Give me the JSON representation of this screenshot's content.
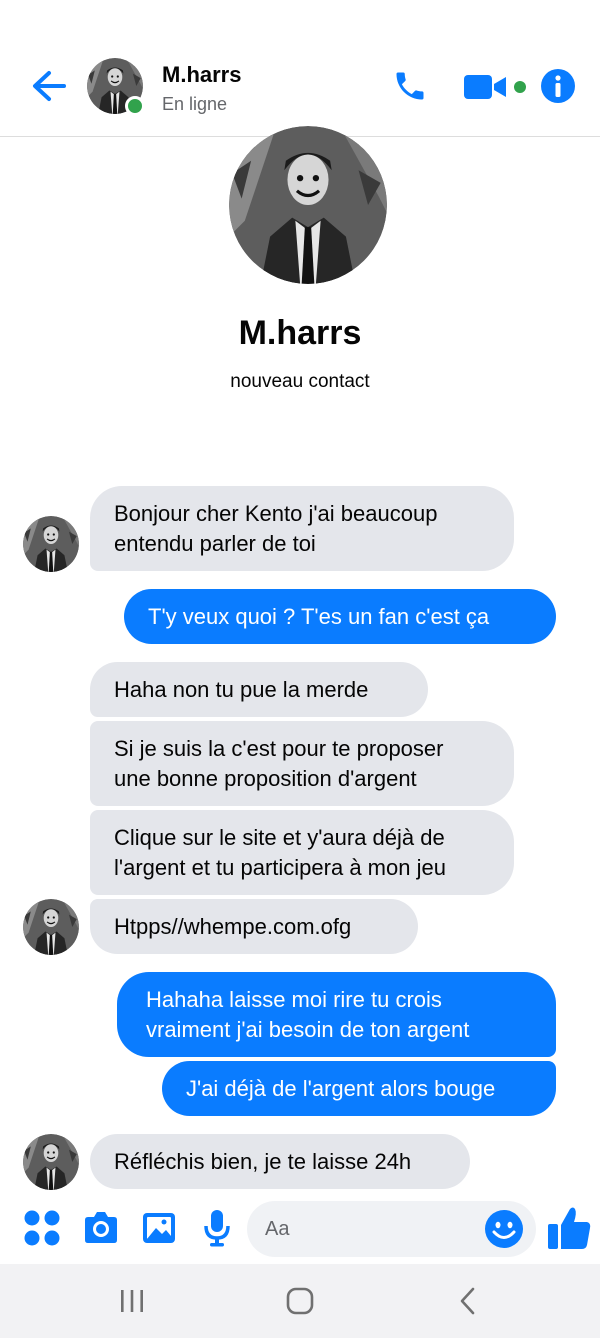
{
  "contact": {
    "name": "M.harrs",
    "status": "En ligne",
    "subtitle": "nouveau contact"
  },
  "header": {
    "back_icon": "arrow-left-icon",
    "call_icon": "phone-icon",
    "video_icon": "video-camera-icon",
    "info_icon": "info-icon"
  },
  "messages": [
    {
      "direction": "incoming",
      "lines": [
        "Bonjour cher Kento j'ai beaucoup",
        "entendu parler de toi"
      ]
    },
    {
      "direction": "outgoing",
      "lines": [
        "T'y veux quoi ? T'es un fan c'est ça"
      ]
    },
    {
      "direction": "incoming",
      "lines": [
        "Haha non tu pue la merde"
      ]
    },
    {
      "direction": "incoming",
      "lines": [
        "Si je suis la c'est pour te proposer",
        "une bonne proposition d'argent"
      ]
    },
    {
      "direction": "incoming",
      "lines": [
        "Clique sur le site et y'aura déjà de",
        "l'argent et tu participera à mon jeu"
      ]
    },
    {
      "direction": "incoming",
      "lines": [
        "Htpps//whempe.com.ofg"
      ]
    },
    {
      "direction": "outgoing",
      "lines": [
        "Hahaha laisse moi rire tu crois",
        "vraiment j'ai besoin de ton argent"
      ]
    },
    {
      "direction": "outgoing",
      "lines": [
        "J'ai déjà de l'argent alors bouge"
      ]
    },
    {
      "direction": "incoming",
      "lines": [
        "Réfléchis bien, je te laisse 24h"
      ]
    }
  ],
  "composer": {
    "placeholder": "Aa",
    "icons": [
      "menu-grid-icon",
      "camera-icon",
      "image-icon",
      "microphone-icon",
      "emoji-icon",
      "thumbs-up-icon"
    ]
  },
  "system_nav": {
    "icons": [
      "recent-apps-icon",
      "home-icon",
      "back-icon"
    ]
  },
  "colors": {
    "accent": "#0a7cff",
    "incoming_bubble": "#e4e6eb",
    "online": "#31a24c"
  }
}
